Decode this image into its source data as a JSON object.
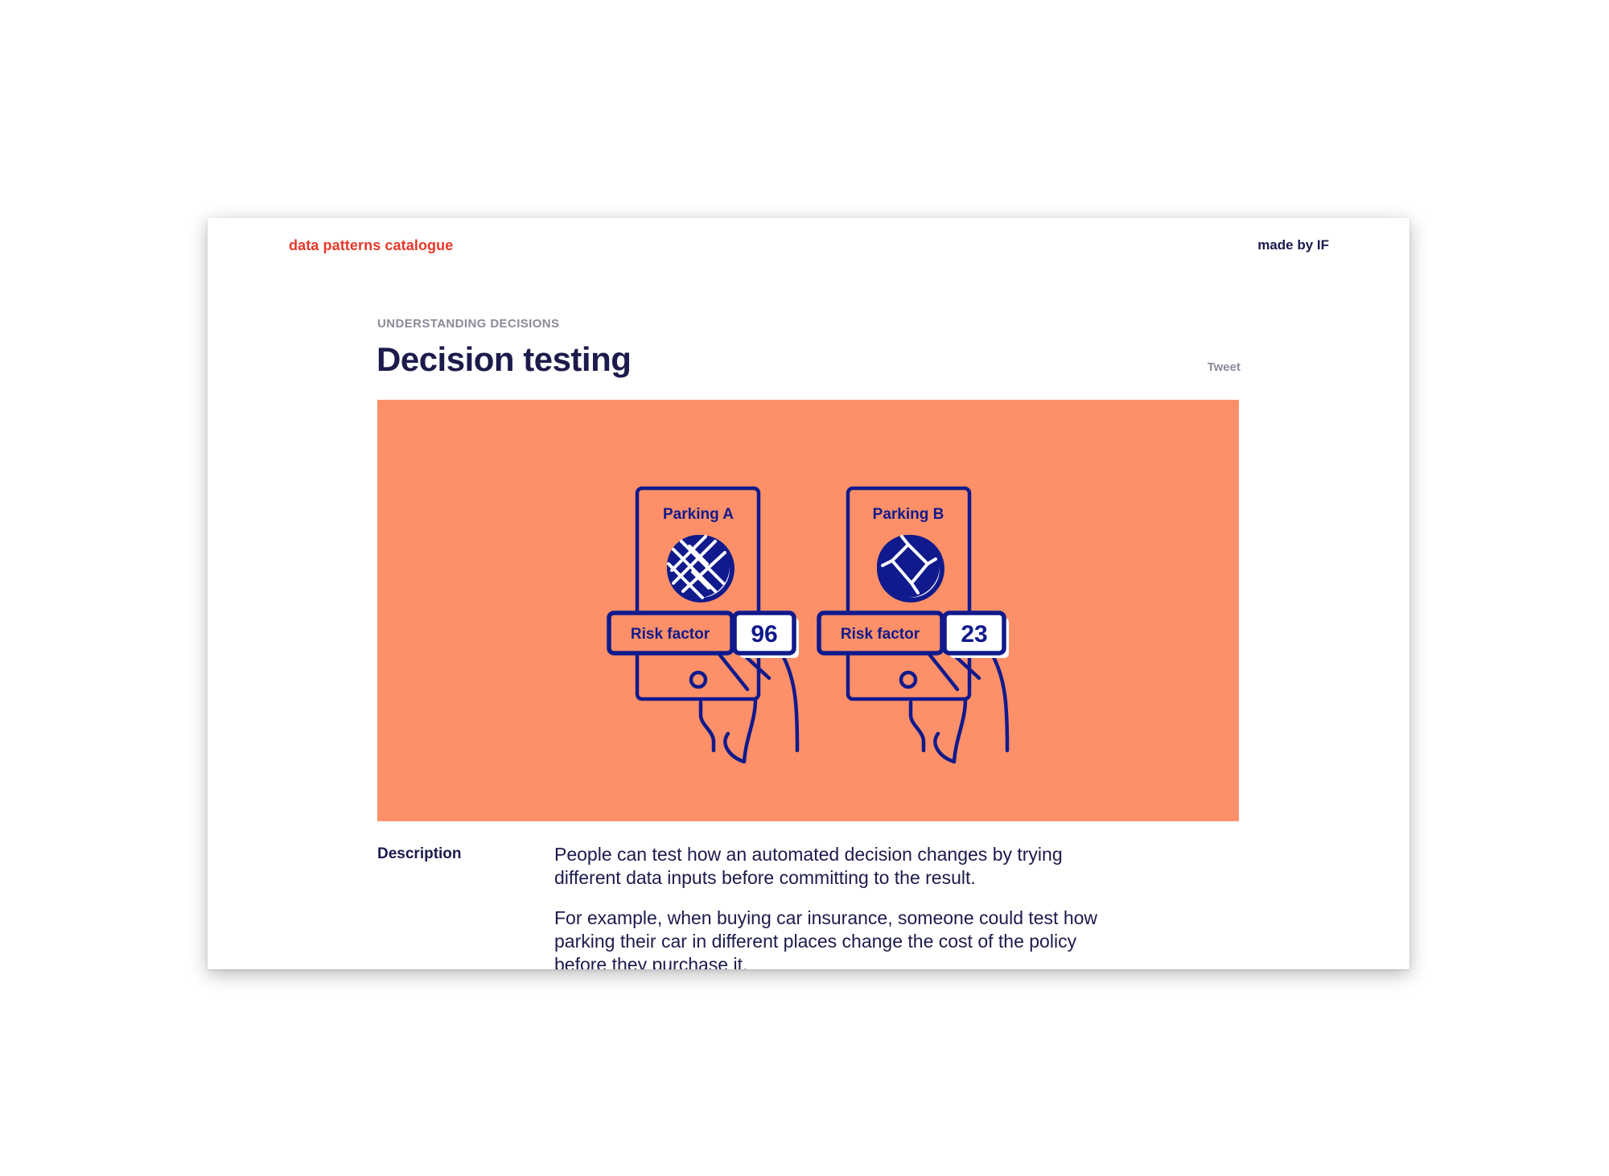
{
  "header": {
    "brand": "data patterns catalogue",
    "made_by": "made by IF"
  },
  "pattern": {
    "category": "UNDERSTANDING DECISIONS",
    "title": "Decision testing",
    "tweet_label": "Tweet"
  },
  "illustration": {
    "background_color": "#fe9069",
    "line_color": "#101a8c",
    "phones": [
      {
        "title": "Parking A",
        "risk_label": "Risk factor",
        "risk_value": "96",
        "map_icon": "dense-street-map-icon"
      },
      {
        "title": "Parking B",
        "risk_label": "Risk factor",
        "risk_value": "23",
        "map_icon": "sparse-street-map-icon"
      }
    ]
  },
  "description": {
    "label": "Description",
    "paragraphs": [
      "People can test how an automated decision changes by trying different data inputs before committing to the result.",
      "For example, when buying car insurance, someone could test how parking their car in different places change the cost of the policy before they purchase it."
    ]
  },
  "colors": {
    "brand": "#e8382a",
    "text": "#1d1b4c",
    "muted": "#8a8a99"
  }
}
